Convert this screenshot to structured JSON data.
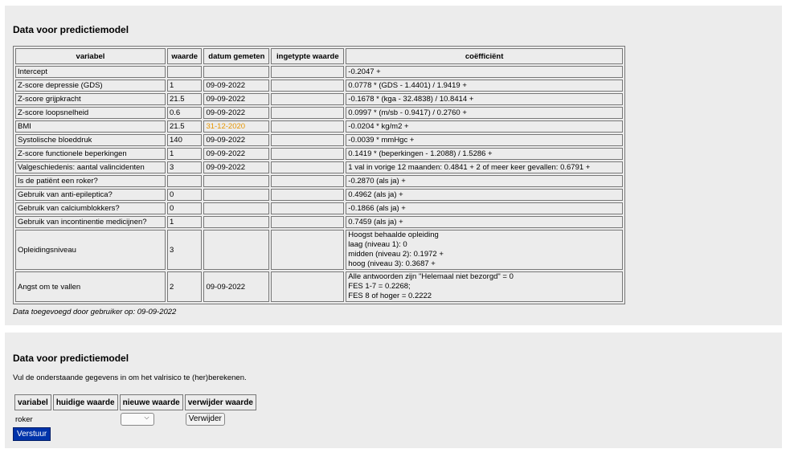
{
  "section1": {
    "title": "Data voor predictiemodel",
    "headers": [
      "variabel",
      "waarde",
      "datum gemeten",
      "ingetypte waarde",
      "coëfficiënt"
    ],
    "rows": [
      {
        "variabel": "Intercept",
        "waarde": "",
        "datum": "",
        "ingetypt": "",
        "coef": "-0.2047 +"
      },
      {
        "variabel": "Z-score depressie (GDS)",
        "waarde": "1",
        "datum": "09-09-2022",
        "ingetypt": "",
        "coef": "0.0778 * (GDS - 1.4401) / 1.9419 +"
      },
      {
        "variabel": "Z-score grijpkracht",
        "waarde": "21.5",
        "datum": "09-09-2022",
        "ingetypt": "",
        "coef": "-0.1678 * (kga - 32.4838) / 10.8414 +"
      },
      {
        "variabel": "Z-score loopsnelheid",
        "waarde": "0.6",
        "datum": "09-09-2022",
        "ingetypt": "",
        "coef": "0.0997 * (m/sb - 0.9417) / 0.2760 +"
      },
      {
        "variabel": "BMI",
        "waarde": "21.5",
        "datum": "31-12-2020",
        "ingetypt": "",
        "coef": "-0.0204 * kg/m2 +"
      },
      {
        "variabel": "Systolische bloeddruk",
        "waarde": "140",
        "datum": "09-09-2022",
        "ingetypt": "",
        "coef": "-0.0039 * mmHgc +"
      },
      {
        "variabel": "Z-score functionele beperkingen",
        "waarde": "1",
        "datum": "09-09-2022",
        "ingetypt": "",
        "coef": "0.1419 * (beperkingen - 1.2088) / 1.5286 +"
      },
      {
        "variabel": "Valgeschiedenis: aantal valincidenten",
        "waarde": "3",
        "datum": "09-09-2022",
        "ingetypt": "",
        "coef": "1 val in vorige 12 maanden: 0.4841 + 2 of meer keer gevallen: 0.6791 +"
      },
      {
        "variabel": "Is de patiënt een roker?",
        "waarde": "",
        "datum": "",
        "ingetypt": "",
        "coef": "-0.2870 (als ja) +"
      },
      {
        "variabel": "Gebruik van anti-epileptica?",
        "waarde": "0",
        "datum": "",
        "ingetypt": "",
        "coef": "0.4962 (als ja) +"
      },
      {
        "variabel": "Gebruik van calciumblokkers?",
        "waarde": "0",
        "datum": "",
        "ingetypt": "",
        "coef": "-0.1866 (als ja) +"
      },
      {
        "variabel": "Gebruik van incontinentie medicijnen?",
        "waarde": "1",
        "datum": "",
        "ingetypt": "",
        "coef": "0.7459 (als ja) +"
      }
    ],
    "opleiding": {
      "variabel": "Opleidingsniveau",
      "waarde": "3",
      "datum": "",
      "ingetypt": "",
      "coef_lines": [
        "Hoogst behaalde opleiding",
        "laag (niveau 1): 0",
        "midden (niveau 2): 0.1972 +",
        "hoog (niveau 3): 0.3687 +"
      ]
    },
    "angst": {
      "variabel": "Angst om te vallen",
      "waarde": "2",
      "datum": "09-09-2022",
      "ingetypt": "",
      "coef_lines": [
        "Alle antwoorden zijn \"Helemaal niet bezorgd\" = 0",
        "FES 1-7 = 0.2268;",
        "FES 8 of hoger = 0.2222"
      ]
    },
    "footnote": "Data toegevoegd door gebruiker op: 09-09-2022",
    "date_highlight_color": "#e69500"
  },
  "section2": {
    "title": "Data voor predictiemodel",
    "intro": "Vul de onderstaande gegevens in om het valrisico te (her)berekenen.",
    "headers": [
      "variabel",
      "huidige waarde",
      "nieuwe waarde",
      "verwijder waarde"
    ],
    "row": {
      "variabel": "roker",
      "huidige": "",
      "nieuwe": "",
      "verwijder_label": "Verwijder"
    },
    "submit_label": "Verstuur",
    "submit_color": "#0033aa"
  }
}
